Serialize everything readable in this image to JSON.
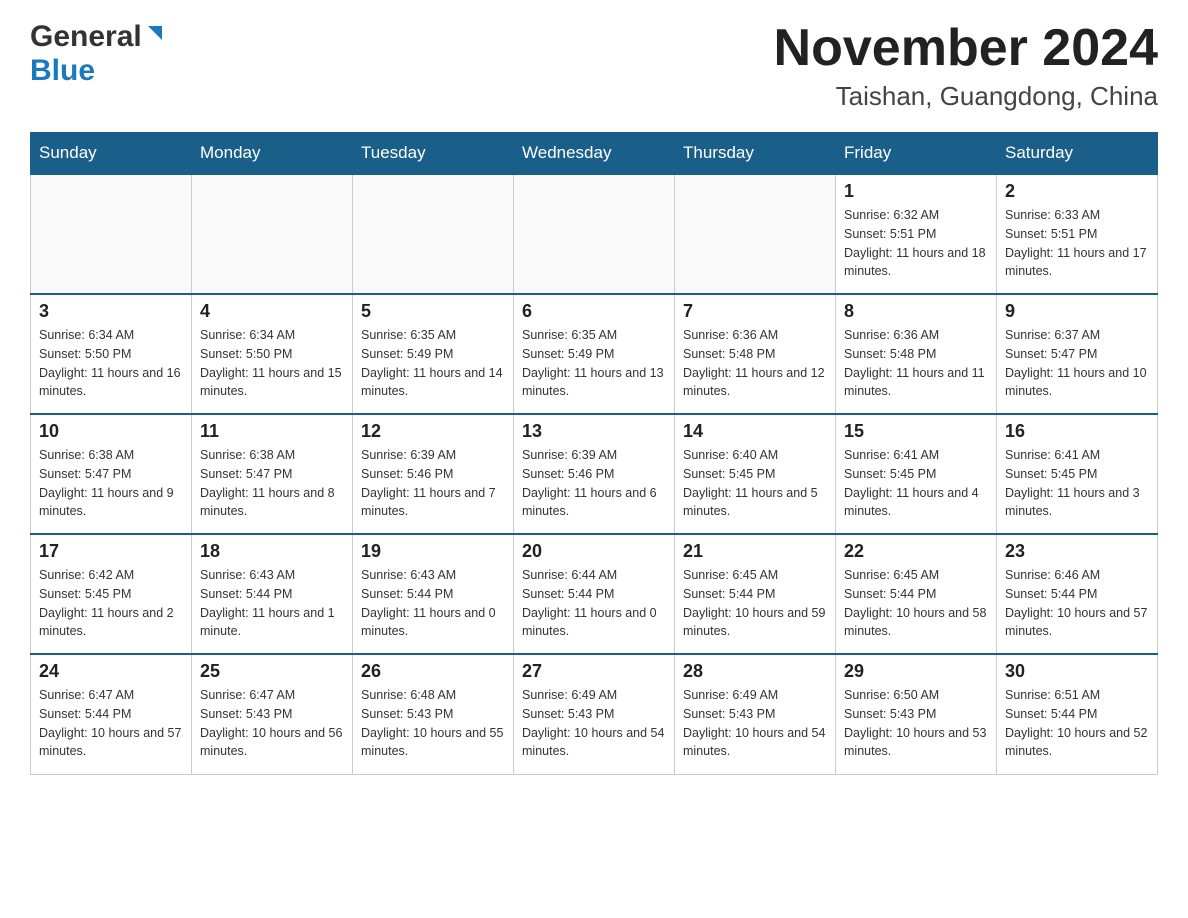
{
  "header": {
    "logo_general": "General",
    "logo_blue": "Blue",
    "title": "November 2024",
    "subtitle": "Taishan, Guangdong, China"
  },
  "weekdays": [
    "Sunday",
    "Monday",
    "Tuesday",
    "Wednesday",
    "Thursday",
    "Friday",
    "Saturday"
  ],
  "weeks": [
    [
      {
        "day": "",
        "info": ""
      },
      {
        "day": "",
        "info": ""
      },
      {
        "day": "",
        "info": ""
      },
      {
        "day": "",
        "info": ""
      },
      {
        "day": "",
        "info": ""
      },
      {
        "day": "1",
        "info": "Sunrise: 6:32 AM\nSunset: 5:51 PM\nDaylight: 11 hours and 18 minutes."
      },
      {
        "day": "2",
        "info": "Sunrise: 6:33 AM\nSunset: 5:51 PM\nDaylight: 11 hours and 17 minutes."
      }
    ],
    [
      {
        "day": "3",
        "info": "Sunrise: 6:34 AM\nSunset: 5:50 PM\nDaylight: 11 hours and 16 minutes."
      },
      {
        "day": "4",
        "info": "Sunrise: 6:34 AM\nSunset: 5:50 PM\nDaylight: 11 hours and 15 minutes."
      },
      {
        "day": "5",
        "info": "Sunrise: 6:35 AM\nSunset: 5:49 PM\nDaylight: 11 hours and 14 minutes."
      },
      {
        "day": "6",
        "info": "Sunrise: 6:35 AM\nSunset: 5:49 PM\nDaylight: 11 hours and 13 minutes."
      },
      {
        "day": "7",
        "info": "Sunrise: 6:36 AM\nSunset: 5:48 PM\nDaylight: 11 hours and 12 minutes."
      },
      {
        "day": "8",
        "info": "Sunrise: 6:36 AM\nSunset: 5:48 PM\nDaylight: 11 hours and 11 minutes."
      },
      {
        "day": "9",
        "info": "Sunrise: 6:37 AM\nSunset: 5:47 PM\nDaylight: 11 hours and 10 minutes."
      }
    ],
    [
      {
        "day": "10",
        "info": "Sunrise: 6:38 AM\nSunset: 5:47 PM\nDaylight: 11 hours and 9 minutes."
      },
      {
        "day": "11",
        "info": "Sunrise: 6:38 AM\nSunset: 5:47 PM\nDaylight: 11 hours and 8 minutes."
      },
      {
        "day": "12",
        "info": "Sunrise: 6:39 AM\nSunset: 5:46 PM\nDaylight: 11 hours and 7 minutes."
      },
      {
        "day": "13",
        "info": "Sunrise: 6:39 AM\nSunset: 5:46 PM\nDaylight: 11 hours and 6 minutes."
      },
      {
        "day": "14",
        "info": "Sunrise: 6:40 AM\nSunset: 5:45 PM\nDaylight: 11 hours and 5 minutes."
      },
      {
        "day": "15",
        "info": "Sunrise: 6:41 AM\nSunset: 5:45 PM\nDaylight: 11 hours and 4 minutes."
      },
      {
        "day": "16",
        "info": "Sunrise: 6:41 AM\nSunset: 5:45 PM\nDaylight: 11 hours and 3 minutes."
      }
    ],
    [
      {
        "day": "17",
        "info": "Sunrise: 6:42 AM\nSunset: 5:45 PM\nDaylight: 11 hours and 2 minutes."
      },
      {
        "day": "18",
        "info": "Sunrise: 6:43 AM\nSunset: 5:44 PM\nDaylight: 11 hours and 1 minute."
      },
      {
        "day": "19",
        "info": "Sunrise: 6:43 AM\nSunset: 5:44 PM\nDaylight: 11 hours and 0 minutes."
      },
      {
        "day": "20",
        "info": "Sunrise: 6:44 AM\nSunset: 5:44 PM\nDaylight: 11 hours and 0 minutes."
      },
      {
        "day": "21",
        "info": "Sunrise: 6:45 AM\nSunset: 5:44 PM\nDaylight: 10 hours and 59 minutes."
      },
      {
        "day": "22",
        "info": "Sunrise: 6:45 AM\nSunset: 5:44 PM\nDaylight: 10 hours and 58 minutes."
      },
      {
        "day": "23",
        "info": "Sunrise: 6:46 AM\nSunset: 5:44 PM\nDaylight: 10 hours and 57 minutes."
      }
    ],
    [
      {
        "day": "24",
        "info": "Sunrise: 6:47 AM\nSunset: 5:44 PM\nDaylight: 10 hours and 57 minutes."
      },
      {
        "day": "25",
        "info": "Sunrise: 6:47 AM\nSunset: 5:43 PM\nDaylight: 10 hours and 56 minutes."
      },
      {
        "day": "26",
        "info": "Sunrise: 6:48 AM\nSunset: 5:43 PM\nDaylight: 10 hours and 55 minutes."
      },
      {
        "day": "27",
        "info": "Sunrise: 6:49 AM\nSunset: 5:43 PM\nDaylight: 10 hours and 54 minutes."
      },
      {
        "day": "28",
        "info": "Sunrise: 6:49 AM\nSunset: 5:43 PM\nDaylight: 10 hours and 54 minutes."
      },
      {
        "day": "29",
        "info": "Sunrise: 6:50 AM\nSunset: 5:43 PM\nDaylight: 10 hours and 53 minutes."
      },
      {
        "day": "30",
        "info": "Sunrise: 6:51 AM\nSunset: 5:44 PM\nDaylight: 10 hours and 52 minutes."
      }
    ]
  ]
}
